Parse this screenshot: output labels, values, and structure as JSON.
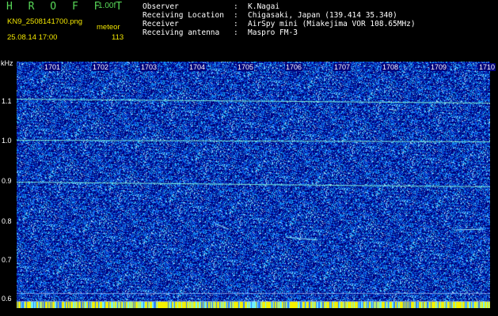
{
  "header": {
    "brand": "H R O F F T",
    "version": "1.00f",
    "filename": "KN9_2508141700.png",
    "meteor_label": "meteor",
    "datetime": "25.08.14 17:00",
    "count": "113",
    "info": [
      {
        "key": "Observer",
        "value": "K.Nagai"
      },
      {
        "key": "Receiving Location",
        "value": "Chigasaki, Japan (139.414 35.340)"
      },
      {
        "key": "Receiver",
        "value": "AirSpy mini (Miakejima VOR 108.65MHz)"
      },
      {
        "key": "Receiving antenna",
        "value": "Maspro FM-3"
      }
    ]
  },
  "axes": {
    "y_unit": "kHz",
    "y_ticks": [
      "1.1",
      "1.0",
      "0.9",
      "0.8",
      "0.7",
      "0.6"
    ],
    "x_ticks": [
      "1701",
      "1702",
      "1703",
      "1704",
      "1705",
      "1706",
      "1707",
      "1708",
      "1709",
      "1710"
    ]
  },
  "colors": {
    "background": "#00007a",
    "noise": "#1a6cff",
    "speck": "#8ff0ff",
    "carrier": "#7ff0d8",
    "brand_green": "#58d858",
    "label_yellow": "#f2e600"
  }
}
